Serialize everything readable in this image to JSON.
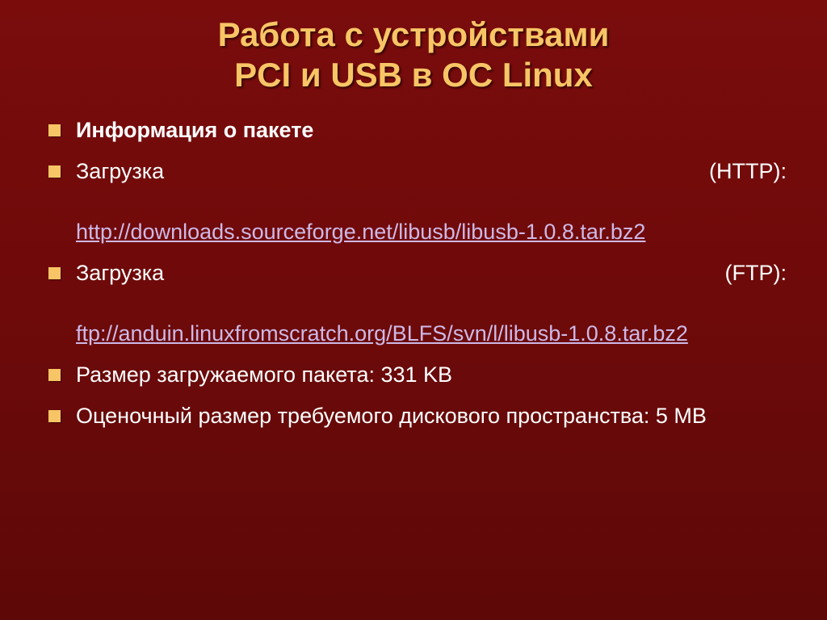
{
  "title_line1": "Работа с устройствами",
  "title_line2": "PCI и USB в ОС Linux",
  "bullets": {
    "b0": {
      "text": "Информация о пакете"
    },
    "b1": {
      "label": "Загрузка",
      "proto": "(HTTP):",
      "link": "http://downloads.sourceforge.net/libusb/libusb-1.0.8.tar.bz2"
    },
    "b2": {
      "label": "Загрузка",
      "proto": "(FTP):",
      "link": "ftp://anduin.linuxfromscratch.org/BLFS/svn/l/libusb-1.0.8.tar.bz2"
    },
    "b3": {
      "text": "Размер загружаемого пакета: 331 KB"
    },
    "b4": {
      "text": "Оценочный размер требуемого дискового пространства: 5 MB"
    }
  }
}
